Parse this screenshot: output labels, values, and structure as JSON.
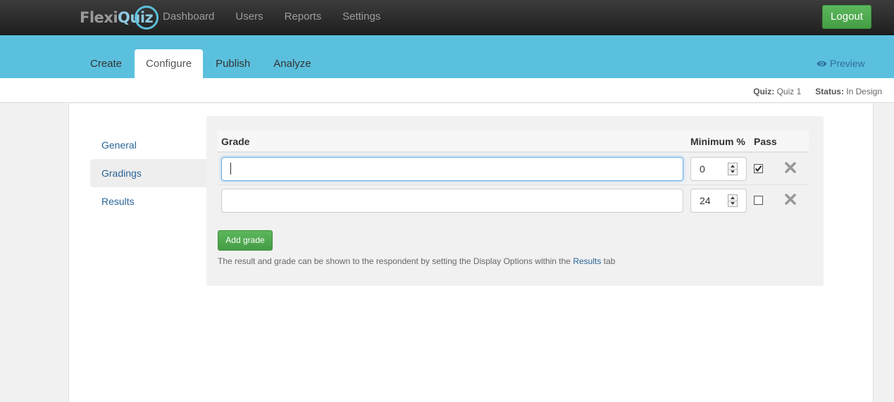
{
  "app": {
    "logo_part1": "Flexi",
    "logo_part2": "Quiz"
  },
  "topnav": {
    "items": [
      "Dashboard",
      "Users",
      "Reports",
      "Settings"
    ],
    "logout_label": "Logout"
  },
  "tabs": {
    "items": [
      "Create",
      "Configure",
      "Publish",
      "Analyze"
    ],
    "active": "Configure",
    "preview_label": "Preview"
  },
  "status": {
    "quiz_label": "Quiz:",
    "quiz_value": "Quiz 1",
    "status_label": "Status:",
    "status_value": "In Design"
  },
  "sidenav": {
    "items": [
      "General",
      "Gradings",
      "Results"
    ],
    "active": "Gradings"
  },
  "grades": {
    "headers": {
      "grade": "Grade",
      "minimum": "Minimum %",
      "pass": "Pass"
    },
    "rows": [
      {
        "grade": "",
        "minimum": "0",
        "pass": true
      },
      {
        "grade": "",
        "minimum": "24",
        "pass": false
      }
    ],
    "add_label": "Add grade",
    "help_text_before": "The result and grade can be shown to the respondent by setting the Display Options within the ",
    "help_link": "Results",
    "help_text_after": " tab"
  },
  "colors": {
    "topbar": "#2b2b2b",
    "tabbar": "#5bc0de",
    "success": "#5cb85c",
    "link": "#2a6496"
  }
}
